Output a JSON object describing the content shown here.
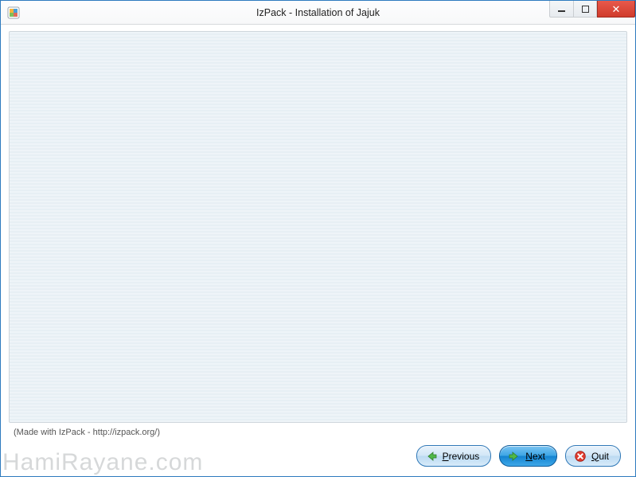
{
  "window": {
    "title": "IzPack - Installation of Jajuk"
  },
  "footer": {
    "made_with": "(Made with IzPack - http://izpack.org/)",
    "buttons": {
      "previous": {
        "label": "Previous",
        "mnemonic": "P"
      },
      "next": {
        "label": "Next",
        "mnemonic": "N"
      },
      "quit": {
        "label": "Quit",
        "mnemonic": "Q"
      }
    }
  },
  "icons": {
    "app": "izpack-box-icon",
    "prev": "arrow-left-icon",
    "next": "arrow-right-icon",
    "quit": "cancel-circle-icon",
    "min": "window-minimize-icon",
    "max": "window-maximize-icon",
    "close": "window-close-icon"
  },
  "watermark": "HamiRayane.com",
  "colors": {
    "window_border": "#2e7bbf",
    "close_button": "#d03b2c",
    "button_accent": "#1483d0",
    "panel_bg": "#eaf1f6"
  }
}
